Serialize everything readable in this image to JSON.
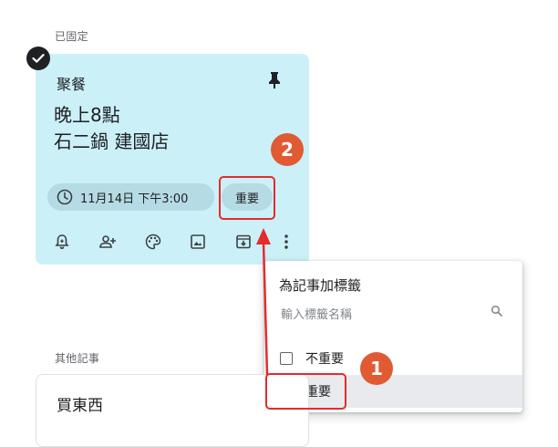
{
  "pinned_section": {
    "label": "已固定",
    "note": {
      "title": "聚餐",
      "body_lines": [
        "晚上8點",
        "石二鍋 建國店"
      ],
      "reminder_chip": "11月14日 下午3:00",
      "label_chip": "重要",
      "toolbar_icons": [
        "remind-me-icon",
        "collaborator-icon",
        "palette-icon",
        "image-icon",
        "archive-icon",
        "more-vert-icon"
      ]
    }
  },
  "label_menu": {
    "title": "為記事加標籤",
    "search_placeholder": "輸入標籤名稱",
    "options": [
      {
        "label": "不重要",
        "checked": false
      },
      {
        "label": "重要",
        "checked": true
      }
    ]
  },
  "annotations": {
    "step1": "1",
    "step2": "2",
    "accent_color": "#e52b2b",
    "badge_color": "#e05a33"
  },
  "other_section": {
    "label": "其他記事",
    "note": {
      "title": "買東西"
    }
  },
  "colors": {
    "note_background": "#cbf0f8",
    "chip_background": "#b5dbe4"
  }
}
